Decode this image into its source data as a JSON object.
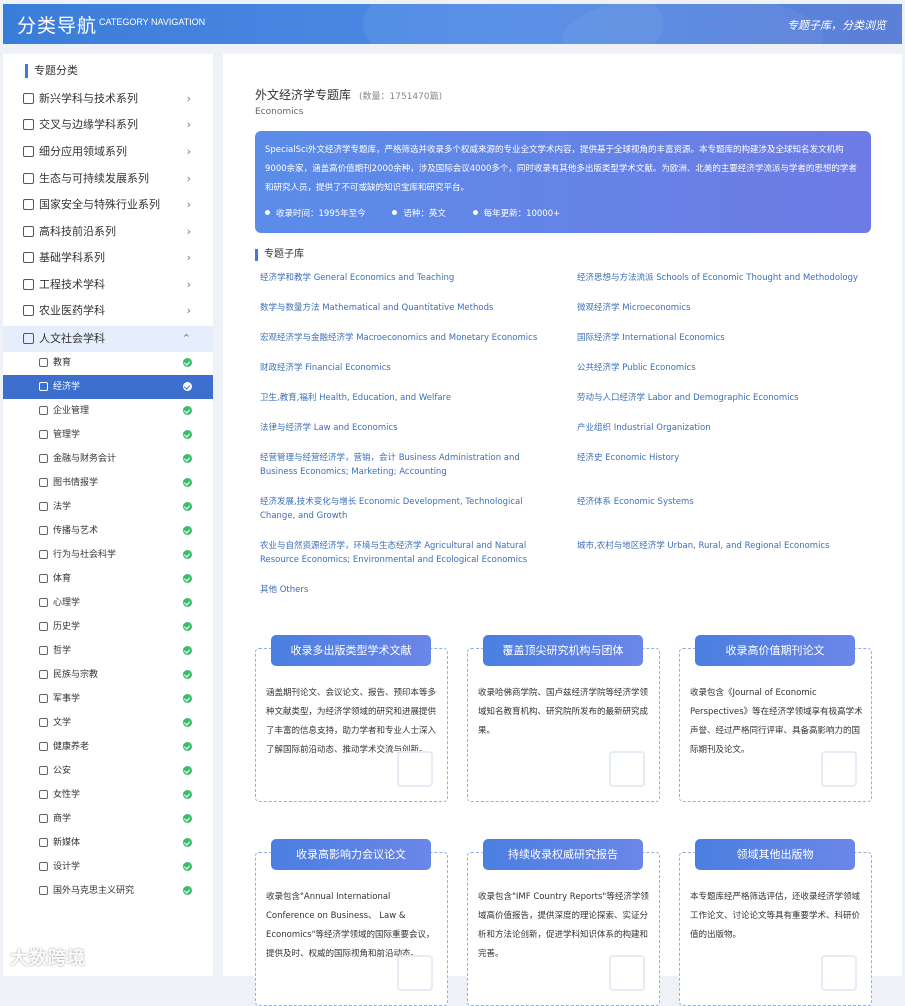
{
  "header": {
    "title": "分类导航",
    "subtitle": "CATEGORY NAVIGATION",
    "right": "专题子库，分类浏览"
  },
  "sidebar": {
    "heading": "专题分类",
    "categories": [
      {
        "label": "新兴学科与技术系列",
        "icon": "atom-icon"
      },
      {
        "label": "交叉与边缘学科系列",
        "icon": "cross-arrows-icon"
      },
      {
        "label": "细分应用领域系列",
        "icon": "grid-icon"
      },
      {
        "label": "生态与可持续发展系列",
        "icon": "leaf-icon"
      },
      {
        "label": "国家安全与特殊行业系列",
        "icon": "shield-icon"
      },
      {
        "label": "高科技前沿系列",
        "icon": "chip-icon"
      },
      {
        "label": "基础学科系列",
        "icon": "diamond-icon"
      },
      {
        "label": "工程技术学科",
        "icon": "tools-icon"
      },
      {
        "label": "农业医药学科",
        "icon": "sprout-icon"
      },
      {
        "label": "人文社会学科",
        "icon": "building-icon"
      }
    ],
    "subitems": [
      {
        "label": "教育",
        "icon": "education-icon"
      },
      {
        "label": "经济学",
        "icon": "economics-icon"
      },
      {
        "label": "企业管理",
        "icon": "org-icon"
      },
      {
        "label": "管理学",
        "icon": "manager-icon"
      },
      {
        "label": "金融与财务会计",
        "icon": "finance-icon"
      },
      {
        "label": "图书情报学",
        "icon": "library-icon"
      },
      {
        "label": "法学",
        "icon": "law-icon"
      },
      {
        "label": "传播与艺术",
        "icon": "art-icon"
      },
      {
        "label": "行为与社会科学",
        "icon": "people-icon"
      },
      {
        "label": "体育",
        "icon": "sports-icon"
      },
      {
        "label": "心理学",
        "icon": "heart-icon"
      },
      {
        "label": "历史学",
        "icon": "history-icon"
      },
      {
        "label": "哲学",
        "icon": "hourglass-icon"
      },
      {
        "label": "民族与宗教",
        "icon": "religion-icon"
      },
      {
        "label": "军事学",
        "icon": "military-icon"
      },
      {
        "label": "文学",
        "icon": "book-icon"
      },
      {
        "label": "健康养老",
        "icon": "home-icon"
      },
      {
        "label": "公安",
        "icon": "police-icon"
      },
      {
        "label": "女性学",
        "icon": "female-icon"
      },
      {
        "label": "商学",
        "icon": "business-icon"
      },
      {
        "label": "新媒体",
        "icon": "media-icon"
      },
      {
        "label": "设计学",
        "icon": "design-icon"
      },
      {
        "label": "国外马克思主义研究",
        "icon": "flag-icon"
      }
    ]
  },
  "main": {
    "title": "外文经济学专题库",
    "count": "(数量：1751470篇)",
    "subtitle_en": "Economics",
    "banner": {
      "text": "SpecialSci外文经济学专题库，严格筛选并收录多个权威来源的专业全文学术内容，提供基于全球视角的丰富资源。本专题库的构建涉及全球知名发文机构9000余家，涵盖高价值期刊2000余种，涉及国际会议4000多个，同时收录有其他多出版类型学术文献。为欧洲、北美的主要经济学流派与学者的思想的学者和研究人员，提供了不可或缺的知识宝库和研究平台。",
      "meta": [
        "收录时间：1995年至今",
        "语种：英文",
        "每年更新：10000+"
      ]
    },
    "section_title": "专题子库",
    "sublibs": [
      "经济学和教学 General Economics and Teaching",
      "经济思想与方法流派 Schools of Economic Thought and Methodology",
      "数学与数量方法 Mathematical and Quantitative Methods",
      "微观经济学 Microeconomics",
      "宏观经济学与金融经济学 Macroeconomics and Monetary Economics",
      "国际经济学 International Economics",
      "财政经济学 Financial Economics",
      "公共经济学 Public Economics",
      "卫生,教育,福利 Health, Education, and Welfare",
      "劳动与人口经济学 Labor and Demographic Economics",
      "法律与经济学 Law and Economics",
      "产业组织 Industrial Organization",
      "经营管理与经营经济学，营销，会计 Business Administration and Business Economics; Marketing; Accounting",
      "经济史 Economic History",
      "经济发展,技术变化与增长 Economic Development, Technological Change, and Growth",
      "经济体系 Economic Systems",
      "农业与自然资源经济学，环境与生态经济学 Agricultural and Natural Resource Economics; Environmental and Ecological Economics",
      "城市,农村与地区经济学 Urban, Rural, and Regional Economics",
      "其他 Others"
    ],
    "cards": [
      {
        "title": "收录多出版类型学术文献",
        "body": "涵盖期刊论文、会议论文、报告、预印本等多种文献类型，为经济学领域的研究和进展提供了丰富的信息支持，助力学者和专业人士深入了解国际前沿动态、推动学术交流与创新。",
        "icon": "document-icon"
      },
      {
        "title": "覆盖顶尖研究机构与团体",
        "body": "收录哈佛商学院、国卢兹经济学院等经济学领域知名教育机构、研究院所发布的最新研究成果。",
        "icon": "people-icon"
      },
      {
        "title": "收录高价值期刊论文",
        "body": "收录包含《Journal of Economic Perspectives》等在经济学领域享有极高学术声誉、经过严格同行评审、具备高影响力的国际期刊及论文。",
        "icon": "network-icon"
      },
      {
        "title": "收录高影响力会议论文",
        "body": "收录包含\"Annual International Conference on Business、 Law & Economics\"等经济学领域的国际重要会议，提供及时、权威的国际视角和前沿动态。",
        "icon": "chart-icon"
      },
      {
        "title": "持续收录权威研究报告",
        "body": "收录包含\"IMF Country Reports\"等经济学领域高价值报告，提供深度的理论探索、实证分析和方法论创新，促进学科知识体系的构建和完善。",
        "icon": "report-icon"
      },
      {
        "title": "领域其他出版物",
        "body": "本专题库经严格筛选评估，还收录经济学领域工作论文、讨论论文等具有重要学术、科研价值的出版物。",
        "icon": "book-icon"
      }
    ]
  },
  "watermark": "大数跨境"
}
